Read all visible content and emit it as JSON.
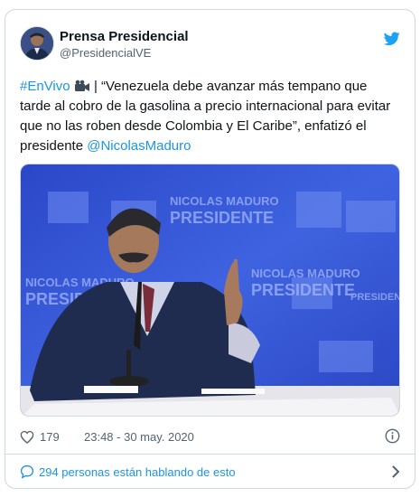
{
  "author": {
    "name": "Prensa Presidencial",
    "handle": "@PresidencialVE"
  },
  "tweet": {
    "hashtag": "#EnVivo",
    "text_after": " | “Venezuela debe avanzar más tempano que tarde al cobro de la gasolina a precio internacional para evitar que no las roben desde Colombia y El Caribe”, enfatizó el presidente ",
    "mention": "@NicolasMaduro"
  },
  "media": {
    "backdrop_text": "NICOLÁS MADURO PRESIDENTE"
  },
  "meta": {
    "likes": "179",
    "timestamp": "23:48 - 30 may. 2020"
  },
  "footer": {
    "talking_label": "294 personas están hablando de esto"
  },
  "colors": {
    "accent": "#1b95e0",
    "text": "#0f1419",
    "muted": "#536471",
    "border": "#cfd9de",
    "backdrop": "#2f4fd0"
  },
  "icons": [
    "twitter-bird-icon",
    "video-camera-icon",
    "heart-icon",
    "info-icon",
    "speech-bubble-icon",
    "chevron-right-icon"
  ]
}
